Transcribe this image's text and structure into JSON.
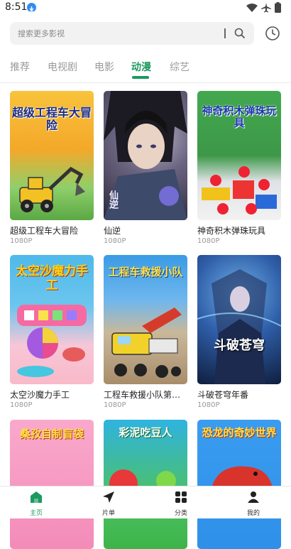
{
  "status": {
    "time": "8:51"
  },
  "search": {
    "placeholder": "搜索更多影视"
  },
  "tabs": [
    {
      "label": "推荐",
      "active": false
    },
    {
      "label": "电视剧",
      "active": false
    },
    {
      "label": "电影",
      "active": false
    },
    {
      "label": "动漫",
      "active": true
    },
    {
      "label": "综艺",
      "active": false
    }
  ],
  "cards": [
    {
      "title": "超级工程车大冒险",
      "sub": "1080P",
      "art": "超级工程车大冒险",
      "color": "#f3a21c"
    },
    {
      "title": "仙逆",
      "sub": "1080P",
      "art": "仙逆",
      "color": "#4a4458"
    },
    {
      "title": "神奇积木弹珠玩具",
      "sub": "1080P",
      "art": "神奇积木弹珠玩具",
      "color": "#2a8e3c"
    },
    {
      "title": "太空沙魔力手工",
      "sub": "1080P",
      "art": "太空沙魔力手工",
      "color": "#4fb6e8"
    },
    {
      "title": "工程车救援小队第二季",
      "sub": "1080P",
      "art": "工程车救援小队",
      "color": "#3aa0e0"
    },
    {
      "title": "斗破苍穹年番",
      "sub": "1080P",
      "art": "斗破苍穹",
      "color": "#1d3b6e"
    },
    {
      "title": "",
      "sub": "",
      "art": "桑孜自制盲袋",
      "color": "#f48bb8"
    },
    {
      "title": "",
      "sub": "",
      "art": "彩泥吃豆人",
      "color": "#3db449"
    },
    {
      "title": "",
      "sub": "",
      "art": "恐龙的奇妙世界",
      "color": "#2e90e8"
    }
  ],
  "nav": [
    {
      "label": "主页",
      "icon": "home-icon",
      "active": true
    },
    {
      "label": "片单",
      "icon": "send-icon",
      "active": false
    },
    {
      "label": "分类",
      "icon": "grid-icon",
      "active": false
    },
    {
      "label": "我的",
      "icon": "user-icon",
      "active": false
    }
  ],
  "colors": {
    "accent": "#1b9a5e"
  }
}
